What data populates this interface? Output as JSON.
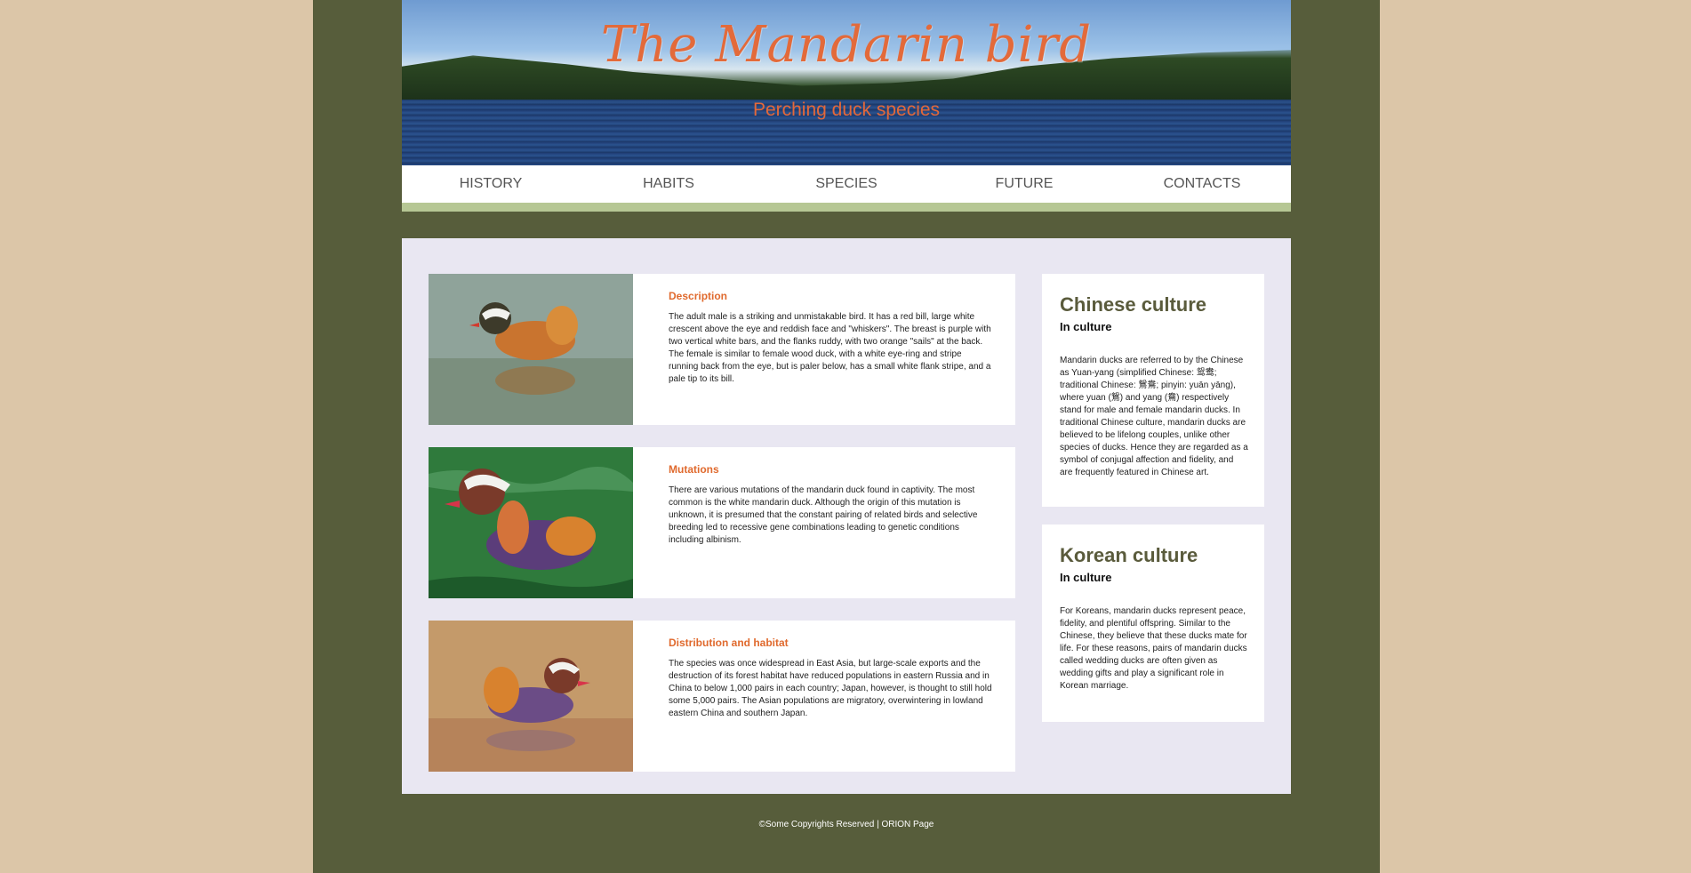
{
  "header": {
    "title": "The Mandarin bird",
    "subtitle": "Perching duck species"
  },
  "nav": {
    "items": [
      {
        "label": "HISTORY"
      },
      {
        "label": "HABITS"
      },
      {
        "label": "SPECIES"
      },
      {
        "label": "FUTURE"
      },
      {
        "label": "CONTACTS"
      }
    ]
  },
  "articles": [
    {
      "heading": "Description",
      "body": "The adult male is a striking and unmistakable bird. It has a red bill, large white crescent above the eye and reddish face and \"whiskers\". The breast is purple with two vertical white bars, and the flanks ruddy, with two orange \"sails\" at the back. The female is similar to female wood duck, with a white eye-ring and stripe running back from the eye, but is paler below, has a small white flank stripe, and a pale tip to its bill."
    },
    {
      "heading": "Mutations",
      "body": "There are various mutations of the mandarin duck found in captivity. The most common is the white mandarin duck. Although the origin of this mutation is unknown, it is presumed that the constant pairing of related birds and selective breeding led to recessive gene combinations leading to genetic conditions including albinism."
    },
    {
      "heading": "Distribution and habitat",
      "body": "The species was once widespread in East Asia, but large-scale exports and the destruction of its forest habitat have reduced populations in eastern Russia and in China to below 1,000 pairs in each country; Japan, however, is thought to still hold some 5,000 pairs. The Asian populations are migratory, overwintering in lowland eastern China and southern Japan."
    }
  ],
  "sidebar": [
    {
      "title": "Chinese culture",
      "subtitle": "In culture",
      "body": "Mandarin ducks are referred to by the Chinese as Yuan-yang (simplified Chinese: 鸳鸯; traditional Chinese: 鴛鴦; pinyin: yuān yāng), where yuan (鴛) and yang (鴦) respectively stand for male and female mandarin ducks. In traditional Chinese culture, mandarin ducks are believed to be lifelong couples, unlike other species of ducks. Hence they are regarded as a symbol of conjugal affection and fidelity, and are frequently featured in Chinese art."
    },
    {
      "title": "Korean culture",
      "subtitle": "In culture",
      "body": "For Koreans, mandarin ducks represent peace, fidelity, and plentiful offspring. Similar to the Chinese, they believe that these ducks mate for life. For these reasons, pairs of mandarin ducks called wedding ducks are often given as wedding gifts and play a significant role in Korean marriage."
    }
  ],
  "footer": {
    "text": "©Some Copyrights Reserved | ORION Page"
  },
  "colors": {
    "accent": "#e06a2e",
    "page_bg": "#575d3b",
    "outer_bg": "#dcc6a8",
    "nav_underline": "#b6c794",
    "content_bg": "#e9e7f2"
  }
}
